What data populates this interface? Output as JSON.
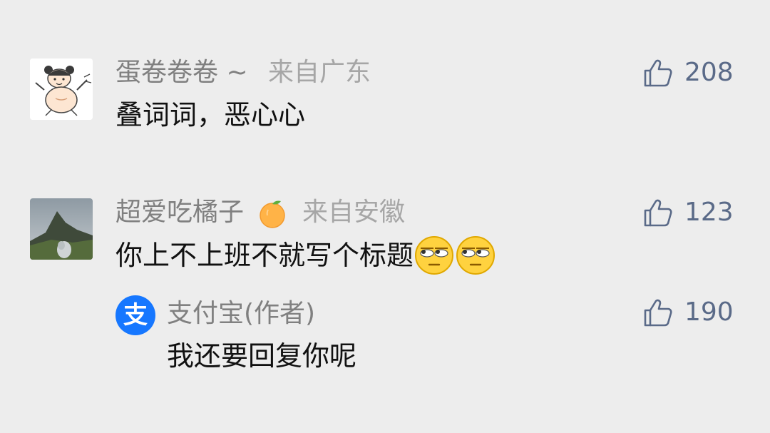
{
  "comments": [
    {
      "nickname": "蛋卷卷卷 ~",
      "location": "来自广东",
      "text": "叠词词，恶心心",
      "likes": "208",
      "avatar": "cartoon-girl-avatar"
    },
    {
      "nickname": "超爱吃橘子",
      "nickname_emoji": "tangerine-emoji",
      "location": "来自安徽",
      "text": "你上不上班不就写个标题",
      "text_emojis": [
        "eye-roll-emoji",
        "eye-roll-emoji"
      ],
      "likes": "123",
      "avatar": "mountain-photo-avatar"
    }
  ],
  "reply": {
    "nickname": "支付宝(作者)",
    "text": "我还要回复你呢",
    "likes": "190",
    "avatar": "alipay-logo-avatar",
    "avatar_glyph": "支",
    "brand_color": "#1677ff"
  },
  "colors": {
    "background": "#ededed",
    "like_icon": "#5a6a88"
  }
}
